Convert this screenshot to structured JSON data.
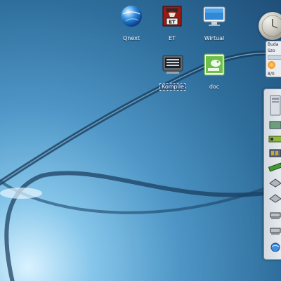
{
  "desktop": {
    "icons": [
      {
        "label": "Qnext",
        "icon": "globe-icon"
      },
      {
        "label": "ET",
        "icon": "enemy-territory-icon"
      },
      {
        "label": "Wirtual",
        "icon": "monitor-icon"
      },
      {
        "label": "Kompile",
        "icon": "terminal-icon"
      },
      {
        "label": "doc",
        "icon": "suse-document-icon"
      }
    ]
  },
  "widgets": {
    "clock": {
      "icon": "clock-icon"
    },
    "weather": {
      "title": "Buda",
      "line2": "Szo",
      "value": "8/0",
      "icon": "sun-icon"
    },
    "launcher": {
      "items": [
        "computer-icon",
        "hardware-icon",
        "network-card-icon",
        "memory-card-icon",
        "ram-icon",
        "drive-icon",
        "drive-icon",
        "network-icon",
        "network-icon",
        "internet-icon"
      ]
    }
  },
  "colors": {
    "wallpaper_dark": "#1f4f79",
    "wallpaper_light": "#d9f2ff",
    "selection": "#2f5e8f"
  }
}
